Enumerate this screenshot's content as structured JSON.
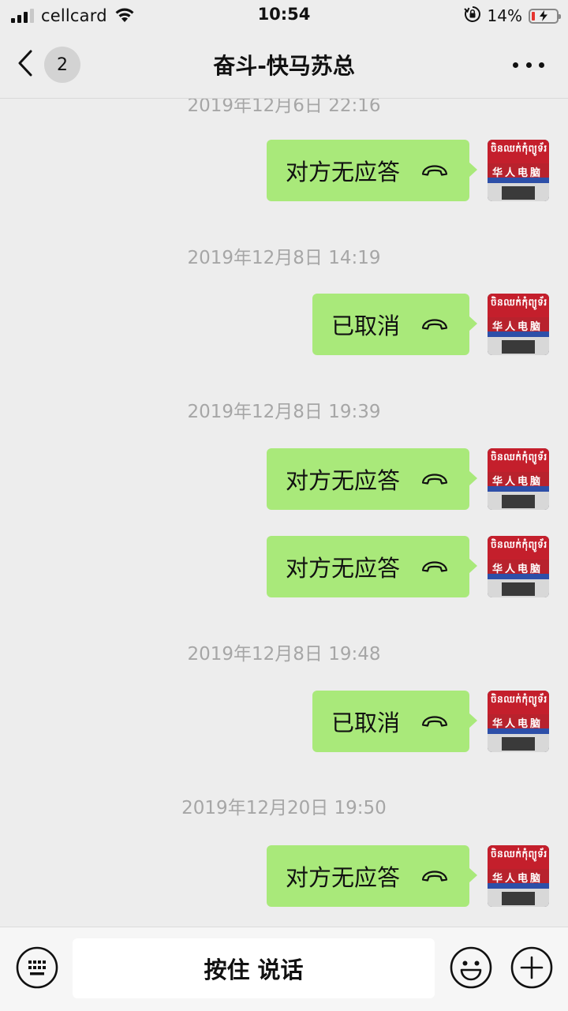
{
  "status_bar": {
    "carrier": "cellcard",
    "time": "10:54",
    "battery_percent": "14%",
    "battery_level": 0.14
  },
  "nav": {
    "back_count": "2",
    "title": "奋斗-快马苏总"
  },
  "avatar": {
    "khmer_text": "ចិនឈក់កុំព្យូទ័រ",
    "chinese_text": "华人电脑"
  },
  "messages": [
    {
      "timestamp": "2019年12月6日 22:16",
      "calls": [
        "对方无应答"
      ]
    },
    {
      "timestamp": "2019年12月8日 14:19",
      "calls": [
        "已取消"
      ]
    },
    {
      "timestamp": "2019年12月8日 19:39",
      "calls": [
        "对方无应答",
        "对方无应答"
      ]
    },
    {
      "timestamp": "2019年12月8日 19:48",
      "calls": [
        "已取消"
      ]
    },
    {
      "timestamp": "2019年12月20日 19:50",
      "calls": [
        "对方无应答"
      ]
    }
  ],
  "input_bar": {
    "hold_to_talk_label": "按住 说话"
  },
  "colors": {
    "background": "#ededed",
    "bubble": "#a9e97a",
    "timestamp_text": "#a6a6a6",
    "battery_low": "#e5352f"
  }
}
